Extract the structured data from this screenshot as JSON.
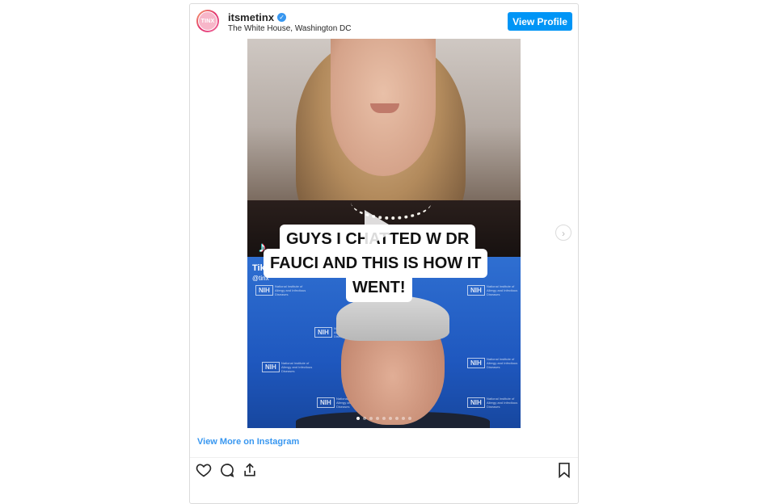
{
  "post": {
    "avatar_text": "TINX",
    "username": "itsmetinx",
    "verified_icon": "verified-badge-icon",
    "location": "The White House, Washington DC",
    "view_profile_label": "View Profile"
  },
  "media": {
    "caption_lines": [
      "GUYS I CHATTED W DR",
      "FAUCI AND THIS IS HOW IT",
      "WENT!"
    ],
    "tiktok_name": "TikTok",
    "tiktok_handle": "@tinx",
    "nih_logo": "NIH",
    "nih_text": "National Institute of Allergy and Infectious Diseases",
    "carousel": {
      "count": 9,
      "active_index": 0
    },
    "next_icon": "chevron-right-icon",
    "play_icon": "play-icon"
  },
  "footer": {
    "view_more_label": "View More on Instagram",
    "actions": [
      "heart-icon",
      "comment-icon",
      "share-icon"
    ],
    "save_icon": "bookmark-icon"
  },
  "colors": {
    "accent": "#0095f6",
    "link": "#3897f0",
    "border": "#dbdbdb"
  }
}
